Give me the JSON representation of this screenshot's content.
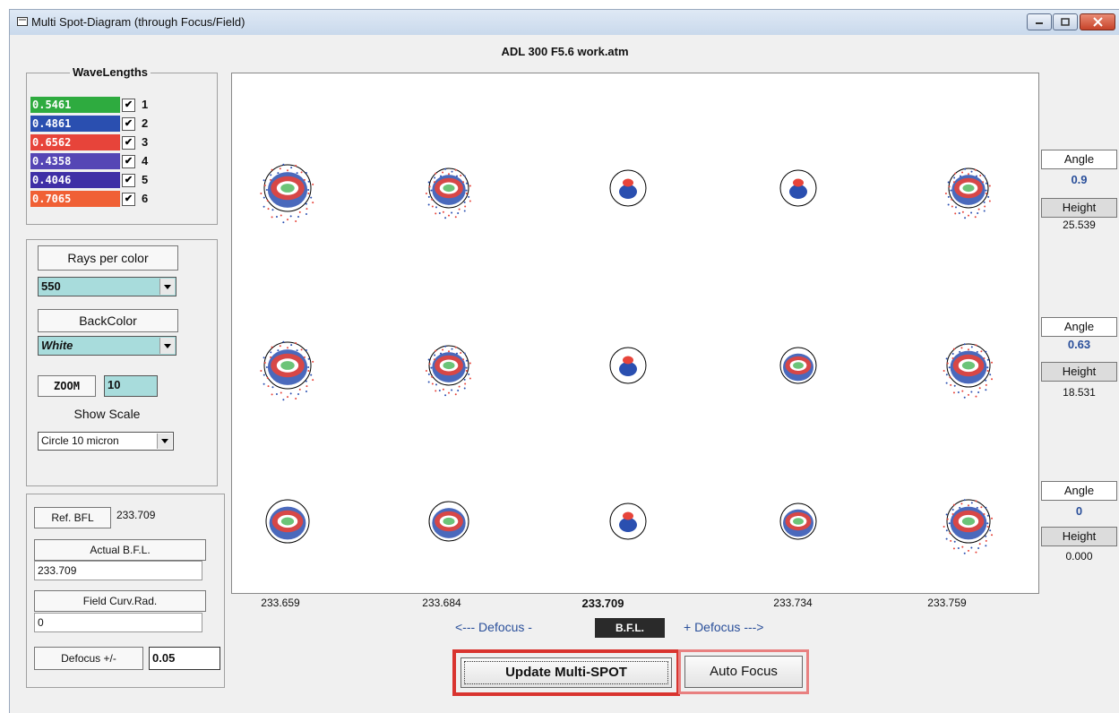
{
  "window": {
    "title": "Multi Spot-Diagram  (through Focus/Field)"
  },
  "file_title": "ADL 300  F5.6 work.atm",
  "wavelengths": {
    "legend": "WaveLengths",
    "items": [
      {
        "value": "0.5461",
        "num": "1",
        "color": "#2eab3f"
      },
      {
        "value": "0.4861",
        "num": "2",
        "color": "#2a4fb0"
      },
      {
        "value": "0.6562",
        "num": "3",
        "color": "#e7443a"
      },
      {
        "value": "0.4358",
        "num": "4",
        "color": "#5546b5"
      },
      {
        "value": "0.4046",
        "num": "5",
        "color": "#3f2fa6"
      },
      {
        "value": "0.7065",
        "num": "6",
        "color": "#f06035"
      }
    ]
  },
  "settings": {
    "rays_label": "Rays per color",
    "rays_value": "550",
    "backcolor_label": "BackColor",
    "backcolor_value": "White",
    "zoom_label": "ZOOM",
    "zoom_value": "10",
    "show_scale_label": "Show Scale",
    "show_scale_value": "Circle 10 micron"
  },
  "bfl": {
    "ref_label": "Ref. BFL",
    "ref_value": "233.709",
    "actual_label": "Actual B.F.L.",
    "actual_value": "233.709",
    "field_label": "Field Curv.Rad.",
    "field_value": "0",
    "defocus_label": "Defocus +/-",
    "defocus_value": "0.05"
  },
  "xticks": [
    "233.659",
    "233.684",
    "233.709",
    "233.734",
    "233.759"
  ],
  "defocus_row": {
    "minus": "<--- Defocus  -",
    "bfl": "B.F.L.",
    "plus": "+ Defocus --->"
  },
  "fields": [
    {
      "angle_label": "Angle",
      "angle": "0.9",
      "height_label": "Height",
      "height": "25.539"
    },
    {
      "angle_label": "Angle",
      "angle": "0.63",
      "height_label": "Height",
      "height": "18.531"
    },
    {
      "angle_label": "Angle",
      "angle": "0",
      "height_label": "Height",
      "height": "0.000"
    }
  ],
  "buttons": {
    "update": "Update  Multi-SPOT",
    "auto": "Auto Focus"
  }
}
